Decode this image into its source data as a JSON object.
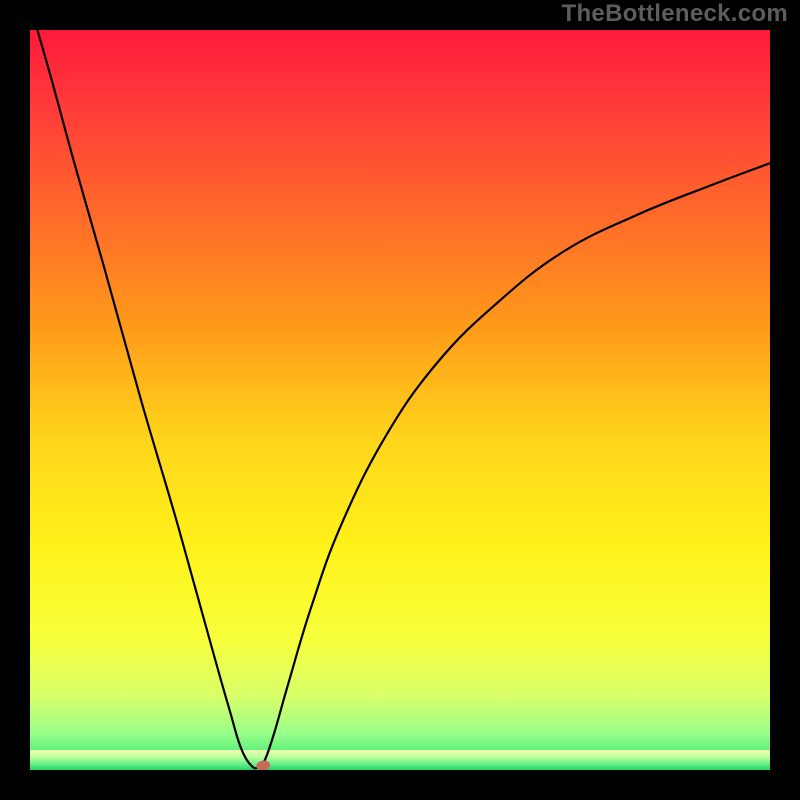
{
  "watermark": "TheBottleneck.com",
  "chart_data": {
    "type": "line",
    "title": "",
    "xlabel": "",
    "ylabel": "",
    "xlim": [
      0,
      100
    ],
    "ylim": [
      0,
      100
    ],
    "grid": false,
    "legend": false,
    "background_gradient": {
      "stops": [
        {
          "offset": 0.0,
          "color": "#ff1a3a"
        },
        {
          "offset": 0.1,
          "color": "#ff3a3a"
        },
        {
          "offset": 0.25,
          "color": "#ff6a2a"
        },
        {
          "offset": 0.4,
          "color": "#ff9a1a"
        },
        {
          "offset": 0.55,
          "color": "#ffd41a"
        },
        {
          "offset": 0.7,
          "color": "#fff21a"
        },
        {
          "offset": 0.82,
          "color": "#f8ff3a"
        },
        {
          "offset": 0.9,
          "color": "#d8ff6a"
        },
        {
          "offset": 0.95,
          "color": "#9aff8a"
        },
        {
          "offset": 1.0,
          "color": "#22e36a"
        }
      ]
    },
    "series": [
      {
        "name": "curve",
        "type": "line",
        "color": "#000000",
        "width": 2.2,
        "x": [
          1,
          3,
          6,
          10,
          15,
          20,
          25,
          27,
          28.5,
          30,
          31,
          31.8,
          33,
          35,
          38,
          42,
          48,
          55,
          63,
          72,
          82,
          92,
          100
        ],
        "values": [
          100,
          93,
          82,
          68,
          50,
          33,
          15,
          8,
          3,
          0.5,
          0.5,
          1.5,
          5,
          12,
          22,
          33,
          45,
          55,
          63,
          70,
          75,
          79,
          82
        ]
      }
    ],
    "marker": {
      "name": "target-marker",
      "x": 31.5,
      "y": 0.6,
      "rx": 7,
      "ry": 5,
      "angle": -10,
      "fill": "#c86a5a"
    },
    "green_band": {
      "y_top": 97.3,
      "y_bottom": 100,
      "stops": [
        {
          "offset": 0.0,
          "color": "#f0ffb0"
        },
        {
          "offset": 0.35,
          "color": "#baff9a"
        },
        {
          "offset": 0.7,
          "color": "#6aef8a"
        },
        {
          "offset": 1.0,
          "color": "#20d464"
        }
      ]
    }
  }
}
